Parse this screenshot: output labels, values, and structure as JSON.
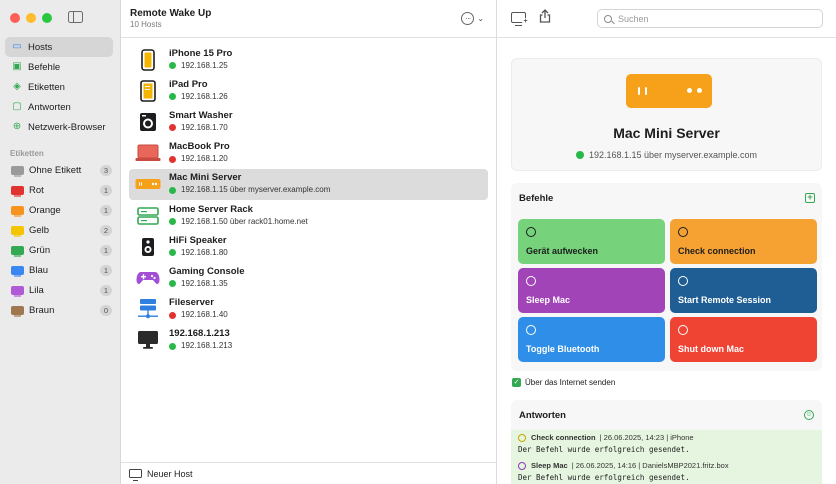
{
  "sidebar": {
    "items": [
      {
        "label": "Hosts",
        "icon": "hosts-icon"
      },
      {
        "label": "Befehle",
        "icon": "commands-icon"
      },
      {
        "label": "Etiketten",
        "icon": "tags-icon"
      },
      {
        "label": "Antworten",
        "icon": "answers-icon"
      },
      {
        "label": "Netzwerk-Browser",
        "icon": "network-icon"
      }
    ],
    "section_label": "Etiketten",
    "tags": [
      {
        "label": "Ohne Etikett",
        "count": "3",
        "color": "#9a9a9a"
      },
      {
        "label": "Rot",
        "count": "1",
        "color": "#e0322e"
      },
      {
        "label": "Orange",
        "count": "1",
        "color": "#f7931e"
      },
      {
        "label": "Gelb",
        "count": "2",
        "color": "#f5c400"
      },
      {
        "label": "Grün",
        "count": "1",
        "color": "#34a853"
      },
      {
        "label": "Blau",
        "count": "1",
        "color": "#3a87f2"
      },
      {
        "label": "Lila",
        "count": "1",
        "color": "#b05bd6"
      },
      {
        "label": "Braun",
        "count": "0",
        "color": "#a07850"
      }
    ]
  },
  "list": {
    "title": "Remote Wake Up",
    "subtitle": "10 Hosts",
    "footer_label": "Neuer Host",
    "hosts": [
      {
        "name": "iPhone 15 Pro",
        "addr": "192.168.1.25",
        "status": "green",
        "icon": "iphone-icon"
      },
      {
        "name": "iPad Pro",
        "addr": "192.168.1.26",
        "status": "green",
        "icon": "ipad-icon"
      },
      {
        "name": "Smart Washer",
        "addr": "192.168.1.70",
        "status": "red",
        "icon": "washer-icon"
      },
      {
        "name": "MacBook Pro",
        "addr": "192.168.1.20",
        "status": "red",
        "icon": "macbook-icon"
      },
      {
        "name": "Mac Mini Server",
        "addr": "192.168.1.15  über  myserver.example.com",
        "status": "green",
        "icon": "mac-mini-icon"
      },
      {
        "name": "Home Server Rack",
        "addr": "192.168.1.50  über  rack01.home.net",
        "status": "green",
        "icon": "server-rack-icon"
      },
      {
        "name": "HiFi Speaker",
        "addr": "192.168.1.80",
        "status": "green",
        "icon": "speaker-icon"
      },
      {
        "name": "Gaming Console",
        "addr": "192.168.1.35",
        "status": "green",
        "icon": "gamepad-icon"
      },
      {
        "name": "Fileserver",
        "addr": "192.168.1.40",
        "status": "red",
        "icon": "fileserver-icon"
      },
      {
        "name": "192.168.1.213",
        "addr": "192.168.1.213",
        "status": "green",
        "icon": "display-icon"
      }
    ]
  },
  "detail": {
    "search_placeholder": "Suchen",
    "title": "Mac Mini Server",
    "addr": "192.168.1.15  über  myserver.example.com",
    "commands_label": "Befehle",
    "commands": [
      {
        "label": "Gerät aufwecken",
        "color": "#76d27b",
        "dark": true
      },
      {
        "label": "Check connection",
        "color": "#f6a233",
        "dark": true
      },
      {
        "label": "Sleep Mac",
        "color": "#a044b8",
        "dark": false
      },
      {
        "label": "Start Remote Session",
        "color": "#1f5e95",
        "dark": false
      },
      {
        "label": "Toggle Bluetooth",
        "color": "#2f8fe8",
        "dark": false
      },
      {
        "label": "Shut down Mac",
        "color": "#ef4434",
        "dark": false
      }
    ],
    "internet_label": "Über das Internet senden",
    "answers_label": "Antworten",
    "answers": [
      {
        "cmd": "Check connection",
        "meta": "|  26.06.2025, 14:23  |  iPhone",
        "text": "Der Befehl wurde erfolgreich gesendet."
      },
      {
        "cmd": "Sleep Mac",
        "meta": "|  26.06.2025, 14:16  |  DanielsMBP2021.fritz.box",
        "text": "Der Befehl wurde erfolgreich gesendet."
      }
    ]
  }
}
